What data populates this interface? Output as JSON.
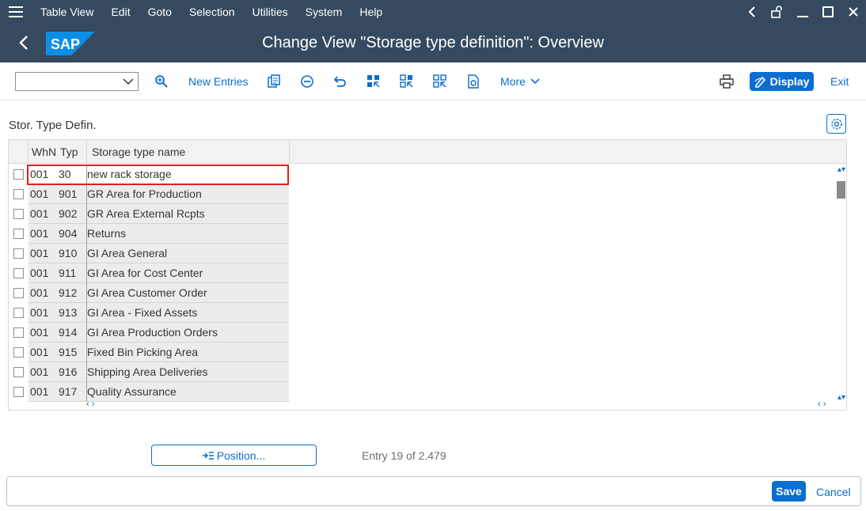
{
  "menu": {
    "items": [
      "Table View",
      "Edit",
      "Goto",
      "Selection",
      "Utilities",
      "System",
      "Help"
    ]
  },
  "header": {
    "logo_text": "SAP",
    "title": "Change View \"Storage type definition\": Overview"
  },
  "toolbar": {
    "tcode_value": "",
    "new_entries": "New Entries",
    "more": "More",
    "display": "Display",
    "exit": "Exit"
  },
  "section": {
    "title": "Stor. Type Defin."
  },
  "table": {
    "headers": {
      "whn": "WhN",
      "typ": "Typ",
      "name": "Storage type name"
    },
    "rows": [
      {
        "whn": "001",
        "typ": "30",
        "name": "new rack storage"
      },
      {
        "whn": "001",
        "typ": "901",
        "name": "GR Area for Production"
      },
      {
        "whn": "001",
        "typ": "902",
        "name": "GR Area External Rcpts"
      },
      {
        "whn": "001",
        "typ": "904",
        "name": "Returns"
      },
      {
        "whn": "001",
        "typ": "910",
        "name": "GI Area General"
      },
      {
        "whn": "001",
        "typ": "911",
        "name": "GI Area for Cost Center"
      },
      {
        "whn": "001",
        "typ": "912",
        "name": "GI Area Customer Order"
      },
      {
        "whn": "001",
        "typ": "913",
        "name": "GI Area - Fixed Assets"
      },
      {
        "whn": "001",
        "typ": "914",
        "name": "GI Area Production Orders"
      },
      {
        "whn": "001",
        "typ": "915",
        "name": "Fixed Bin Picking Area"
      },
      {
        "whn": "001",
        "typ": "916",
        "name": "Shipping Area Deliveries"
      },
      {
        "whn": "001",
        "typ": "917",
        "name": "Quality Assurance"
      }
    ]
  },
  "position_button": "Position...",
  "entry_info": "Entry 19 of 2.479",
  "footer": {
    "save": "Save",
    "cancel": "Cancel"
  },
  "colors": {
    "shell": "#354a5f",
    "accent": "#0a6ed1",
    "highlight": "#e0201b"
  }
}
